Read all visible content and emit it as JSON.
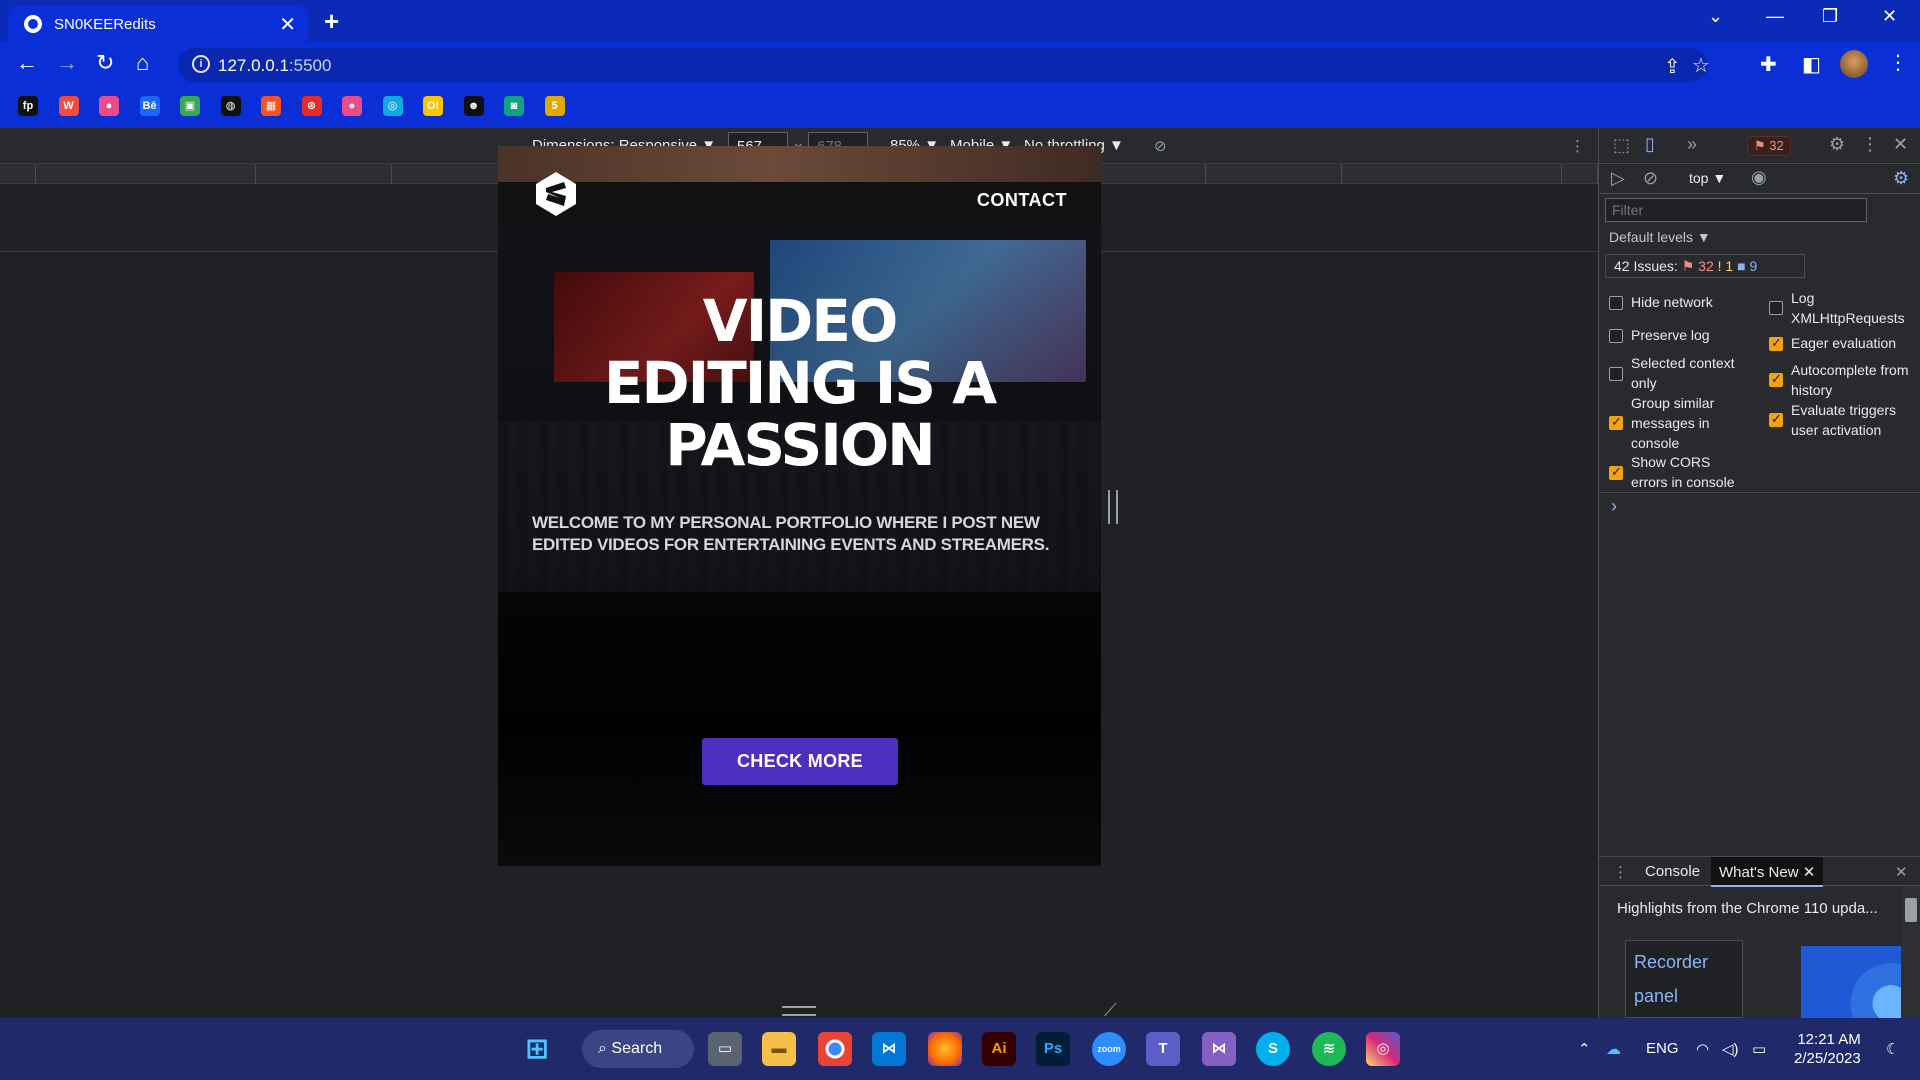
{
  "browser": {
    "tab_title": "SN0KEERedits",
    "tab_close": "✕",
    "new_tab": "+",
    "url_host": "127.0.0.1",
    "url_port": ":5500",
    "window_controls": {
      "tabs_list": "⌄",
      "minimize": "—",
      "restore": "❐",
      "close": "✕"
    },
    "nav": {
      "back": "←",
      "forward": "→",
      "reload": "↻",
      "home": "⌂"
    },
    "bookmarks": [
      {
        "icon": "fp",
        "color": "#111111"
      },
      {
        "icon": "W",
        "color": "#f24c3d"
      },
      {
        "icon": "●",
        "color": "#ea4c89"
      },
      {
        "icon": "Bē",
        "color": "#1769ff"
      },
      {
        "icon": "▣",
        "color": "#34a853"
      },
      {
        "icon": "◍",
        "color": "#111111"
      },
      {
        "icon": "▦",
        "color": "#f35325"
      },
      {
        "icon": "⊛",
        "color": "#e62b2b"
      },
      {
        "icon": "●",
        "color": "#ea4c89"
      },
      {
        "icon": "◎",
        "color": "#12a8e0"
      },
      {
        "icon": "O!",
        "color": "#f7c600"
      },
      {
        "icon": "☻",
        "color": "#111111"
      },
      {
        "icon": "◙",
        "color": "#10a37f"
      },
      {
        "icon": "5",
        "color": "#e0a800"
      }
    ]
  },
  "device_toolbar": {
    "dimensions": "Dimensions: Responsive ▼",
    "width": "567",
    "times": "×",
    "height": "678",
    "zoom": "85% ▼",
    "device": "Mobile ▼",
    "throttling": "No throttling ▼"
  },
  "site": {
    "nav_contact": "CONTACT",
    "hero_line1": "VIDEO",
    "hero_line2": "EDITING IS A",
    "hero_line3": "PASSION",
    "welcome": "WELCOME TO MY PERSONAL PORTFOLIO WHERE I POST NEW EDITED VIDEOS FOR ENTERTAINING EVENTS AND STREAMERS.",
    "cta": "CHECK MORE"
  },
  "devtools": {
    "error_count": "32",
    "context": "top ▼",
    "filter_placeholder": "Filter",
    "levels": "Default levels ▼",
    "issues_label": "42 Issues:",
    "issues_errors": "32",
    "issues_warnings": "1",
    "issues_info": "9",
    "settings": [
      {
        "label": "Hide network",
        "checked": false
      },
      {
        "label": "Preserve log",
        "checked": false
      },
      {
        "label": "Selected context only",
        "checked": false
      },
      {
        "label": "Group similar messages in console",
        "checked": true
      },
      {
        "label": "Show CORS errors in console",
        "checked": true
      },
      {
        "label": "Log XMLHttpRequests",
        "checked": false
      },
      {
        "label": "Eager evaluation",
        "checked": true
      },
      {
        "label": "Autocomplete from history",
        "checked": true
      },
      {
        "label": "Evaluate triggers user activation",
        "checked": true
      }
    ],
    "prompt": "›",
    "drawer": {
      "tab_console": "Console",
      "tab_whats_new": "What's New",
      "highlight": "Highlights from the Chrome 110 upda...",
      "card_title_1": "Recorder",
      "card_title_2": "panel"
    }
  },
  "taskbar": {
    "search": "Search",
    "language": "ENG",
    "time": "12:21 AM",
    "date": "2/25/2023"
  }
}
